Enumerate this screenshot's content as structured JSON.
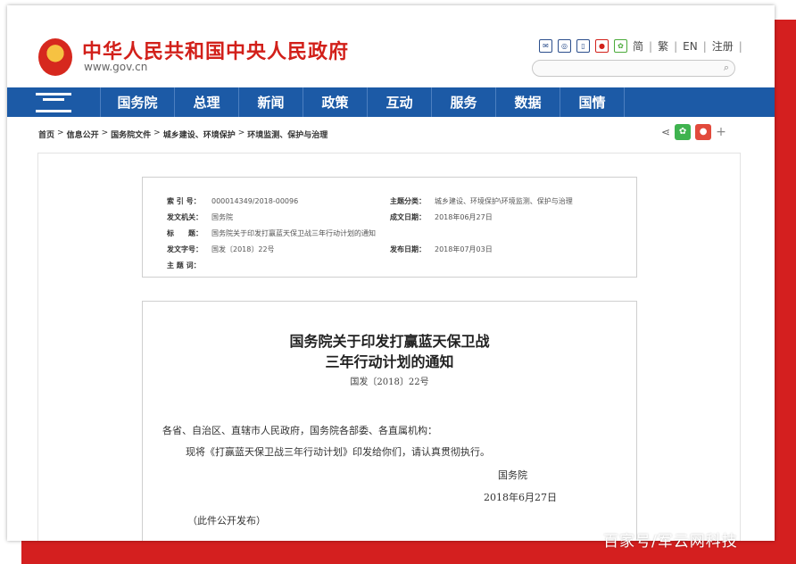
{
  "header": {
    "site_title": "中华人民共和国中央人民政府",
    "site_url": "www.gov.cn",
    "links": [
      "简",
      "繁",
      "EN",
      "注册"
    ]
  },
  "nav": {
    "items": [
      "国务院",
      "总理",
      "新闻",
      "政策",
      "互动",
      "服务",
      "数据",
      "国情"
    ]
  },
  "breadcrumb": [
    "首页",
    "信息公开",
    "国务院文件",
    "城乡建设、环境保护",
    "环境监测、保护与治理"
  ],
  "meta": {
    "index_label": "索 引 号：",
    "index_value": "000014349/2018-00096",
    "category_label": "主题分类：",
    "category_value": "城乡建设、环境保护\\环境监测、保护与治理",
    "issuer_label": "发文机关：",
    "issuer_value": "国务院",
    "created_label": "成文日期：",
    "created_value": "2018年06月27日",
    "title_label": "标　　题：",
    "title_value": "国务院关于印发打赢蓝天保卫战三年行动计划的通知",
    "docno_label": "发文字号：",
    "docno_value": "国发〔2018〕22号",
    "published_label": "发布日期：",
    "published_value": "2018年07月03日",
    "keywords_label": "主 题 词：",
    "keywords_value": ""
  },
  "document": {
    "title_line1": "国务院关于印发打赢蓝天保卫战",
    "title_line2": "三年行动计划的通知",
    "doc_number": "国发〔2018〕22号",
    "salutation": "各省、自治区、直辖市人民政府，国务院各部委、各直属机构：",
    "body": "现将《打赢蓝天保卫战三年行动计划》印发给你们，请认真贯彻执行。",
    "signer": "国务院",
    "date": "2018年6月27日",
    "note": "（此件公开发布）"
  },
  "watermark": "百家号/军云网科技"
}
